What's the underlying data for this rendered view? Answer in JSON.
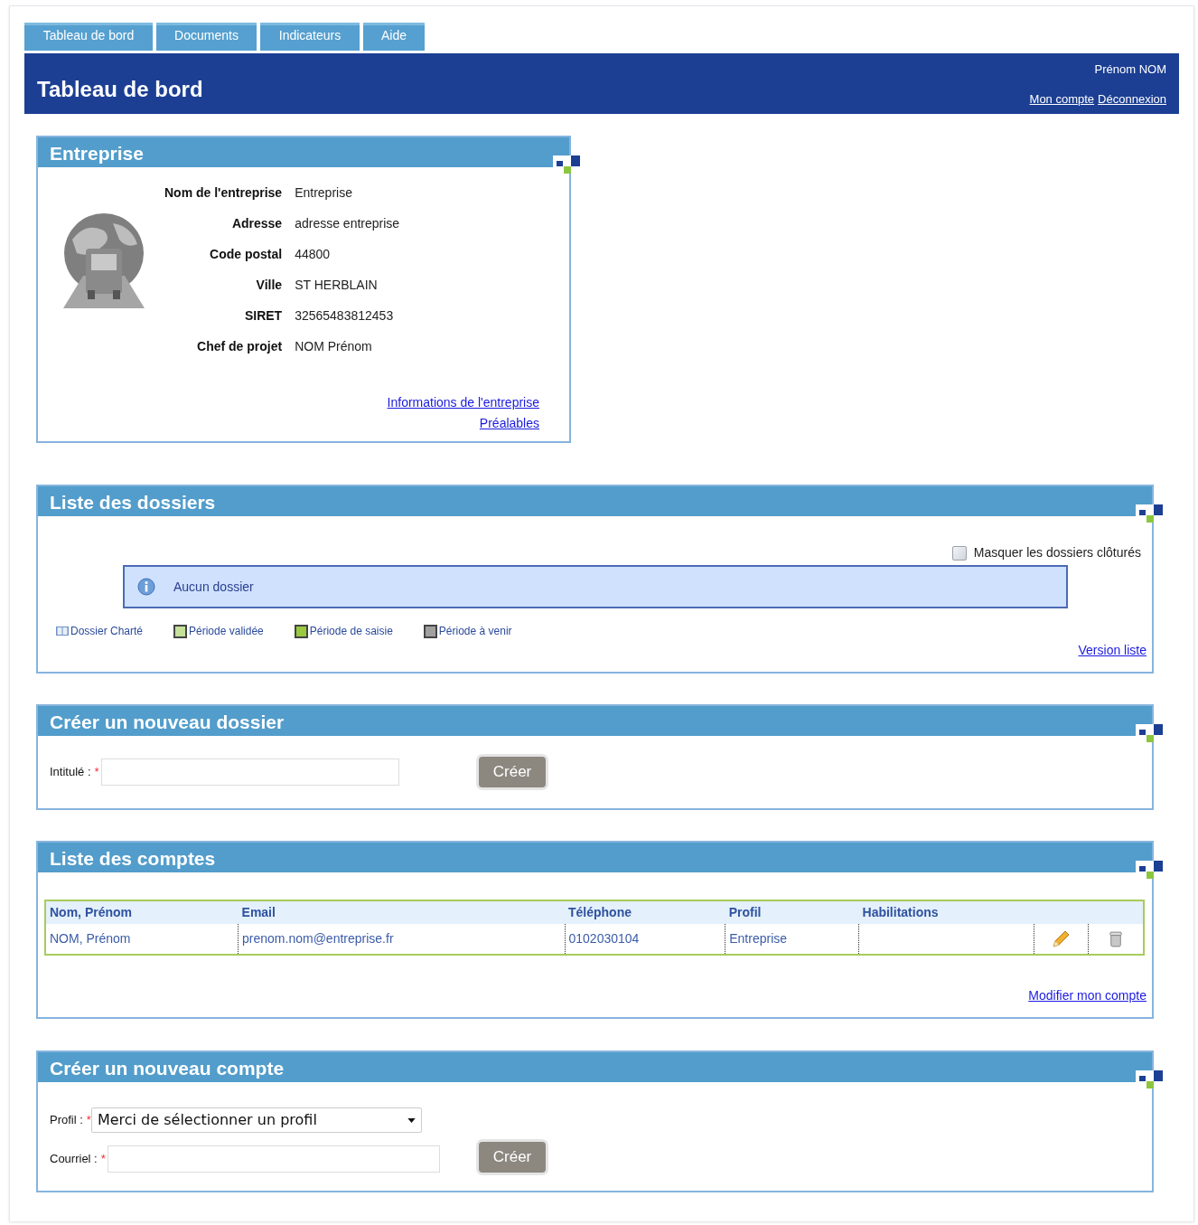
{
  "nav_tabs": [
    {
      "label": "Tableau de bord"
    },
    {
      "label": "Documents"
    },
    {
      "label": "Indicateurs"
    },
    {
      "label": "Aide"
    }
  ],
  "header": {
    "title": "Tableau de bord",
    "user": "Prénom NOM",
    "links": [
      "Mon compte",
      "Déconnexion"
    ]
  },
  "company_panel": {
    "title": "Entreprise",
    "fields": [
      {
        "label": "Nom de l'entreprise",
        "value": "Entreprise"
      },
      {
        "label": "Adresse",
        "value": "adresse entreprise"
      },
      {
        "label": "Code postal",
        "value": "44800"
      },
      {
        "label": "Ville",
        "value": "ST HERBLAIN"
      },
      {
        "label": "SIRET",
        "value": "32565483812453"
      },
      {
        "label": "Chef de projet",
        "value": "NOM Prénom"
      }
    ],
    "links": [
      "Informations de l'entreprise",
      "Préalables"
    ]
  },
  "folders_panel": {
    "title": "Liste des dossiers",
    "hide_closed": {
      "label": "Masquer les dossiers clôturés",
      "checked": false
    },
    "message": "Aucun dossier",
    "legend": [
      {
        "kind": "icon",
        "label": "Dossier Charté"
      },
      {
        "kind": "swatch",
        "label": "Période validée",
        "color": "#c5e09a"
      },
      {
        "kind": "swatch",
        "label": "Période de saisie",
        "color": "#99c93c"
      },
      {
        "kind": "swatch",
        "label": "Période à venir",
        "color": "#a0a0a0"
      }
    ],
    "link": "Version liste"
  },
  "new_folder_panel": {
    "title": "Créer un nouveau dossier",
    "field": {
      "label": "Intitulé :",
      "required_mark": "*"
    },
    "button": "Créer"
  },
  "accounts_panel": {
    "title": "Liste des comptes",
    "table": {
      "columns": [
        "Nom, Prénom",
        "Email",
        "Téléphone",
        "Profil",
        "Habilitations"
      ],
      "rows": [
        {
          "cells": [
            "NOM, Prénom",
            "prenom.nom@entreprise.fr",
            "0102030104",
            "Entreprise"
          ]
        }
      ]
    },
    "link": "Modifier mon compte"
  },
  "new_account_panel": {
    "title": "Créer un nouveau compte",
    "profile": {
      "label": "Profil :",
      "required_mark": "*",
      "value": "Merci de sélectionner un profil"
    },
    "email": {
      "label": "Courriel :",
      "required_mark": "*"
    },
    "button": "Créer"
  }
}
